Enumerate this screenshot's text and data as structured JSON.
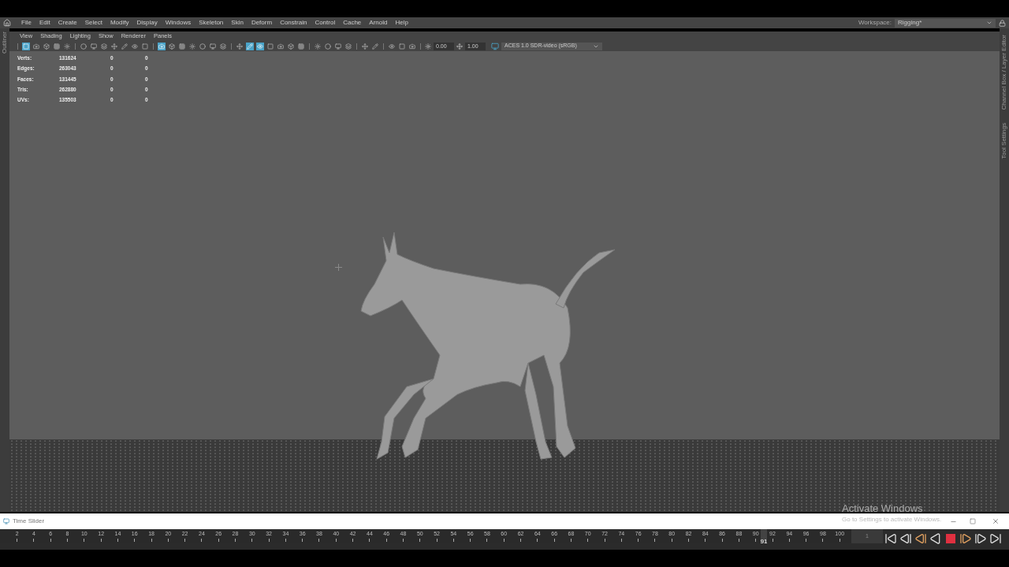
{
  "menu_bar": {
    "items": [
      "File",
      "Edit",
      "Create",
      "Select",
      "Modify",
      "Display",
      "Windows",
      "Skeleton",
      "Skin",
      "Deform",
      "Constrain",
      "Control",
      "Cache",
      "Arnold",
      "Help"
    ],
    "workspace_label": "Workspace:",
    "workspace_value": "Rigging*"
  },
  "left_panel": {
    "tab": "Outliner"
  },
  "right_panel": {
    "tabs": [
      "Channel Box / Layer Editor",
      "Tool Settings"
    ]
  },
  "panel_menu": [
    "View",
    "Shading",
    "Lighting",
    "Show",
    "Renderer",
    "Panels"
  ],
  "toolbar": {
    "groups": [
      [
        {
          "selected": true
        },
        {
          "selected": false
        },
        {
          "selected": false
        },
        {
          "selected": false
        },
        {
          "selected": false
        }
      ],
      [
        {
          "selected": false
        },
        {
          "selected": false
        },
        {
          "selected": false
        },
        {
          "selected": false
        },
        {
          "selected": false
        },
        {
          "selected": false
        },
        {
          "selected": false
        }
      ],
      [
        {
          "selected": true
        },
        {
          "selected": false
        },
        {
          "selected": false
        },
        {
          "selected": false
        },
        {
          "selected": false
        },
        {
          "selected": false
        },
        {
          "selected": false
        }
      ],
      [
        {
          "selected": false
        },
        {
          "selected": true
        },
        {
          "selected": true
        },
        {
          "selected": false
        },
        {
          "selected": false
        },
        {
          "selected": false
        },
        {
          "selected": false
        }
      ],
      [
        {
          "selected": false
        },
        {
          "selected": false
        },
        {
          "selected": false
        },
        {
          "selected": false
        }
      ],
      [
        {
          "selected": false
        },
        {
          "selected": false
        }
      ],
      [
        {
          "selected": false
        },
        {
          "selected": false
        },
        {
          "selected": false
        }
      ]
    ],
    "exposure": "0.00",
    "gamma": "1.00",
    "color_space": "ACES 1.0 SDR-video (sRGB)"
  },
  "stats": [
    {
      "label": "Verts:",
      "value": "131624",
      "column_3": "0",
      "column_4": "0"
    },
    {
      "label": "Edges:",
      "value": "263043",
      "column_3": "0",
      "column_4": "0"
    },
    {
      "label": "Faces:",
      "value": "131445",
      "column_3": "0",
      "column_4": "0"
    },
    {
      "label": "Tris:",
      "value": "262880",
      "column_3": "0",
      "column_4": "0"
    },
    {
      "label": "UVs:",
      "value": "135503",
      "column_3": "0",
      "column_4": "0"
    }
  ],
  "time_slider": {
    "title": "Time Slider",
    "ticks": [
      "2",
      "4",
      "6",
      "8",
      "10",
      "12",
      "14",
      "16",
      "18",
      "20",
      "22",
      "24",
      "26",
      "28",
      "30",
      "32",
      "34",
      "36",
      "38",
      "40",
      "42",
      "44",
      "46",
      "48",
      "50",
      "52",
      "54",
      "56",
      "58",
      "60",
      "62",
      "64",
      "66",
      "68",
      "70",
      "72",
      "74",
      "76",
      "78",
      "80",
      "82",
      "84",
      "86",
      "88",
      "90",
      "92",
      "94",
      "96",
      "98",
      "100"
    ],
    "current_frame": "91",
    "level": 0.91,
    "current_time": "1"
  },
  "playback_buttons": [
    {
      "kind": "start"
    },
    {
      "kind": "prev_key"
    },
    {
      "kind": "prev_frame"
    },
    {
      "kind": "play_back"
    },
    {
      "kind": "stop"
    },
    {
      "kind": "next_frame"
    },
    {
      "kind": "next_key"
    },
    {
      "kind": "end"
    }
  ],
  "activation_notice": {
    "title": "Activate Windows",
    "message": "Go to Settings to activate Windows."
  }
}
